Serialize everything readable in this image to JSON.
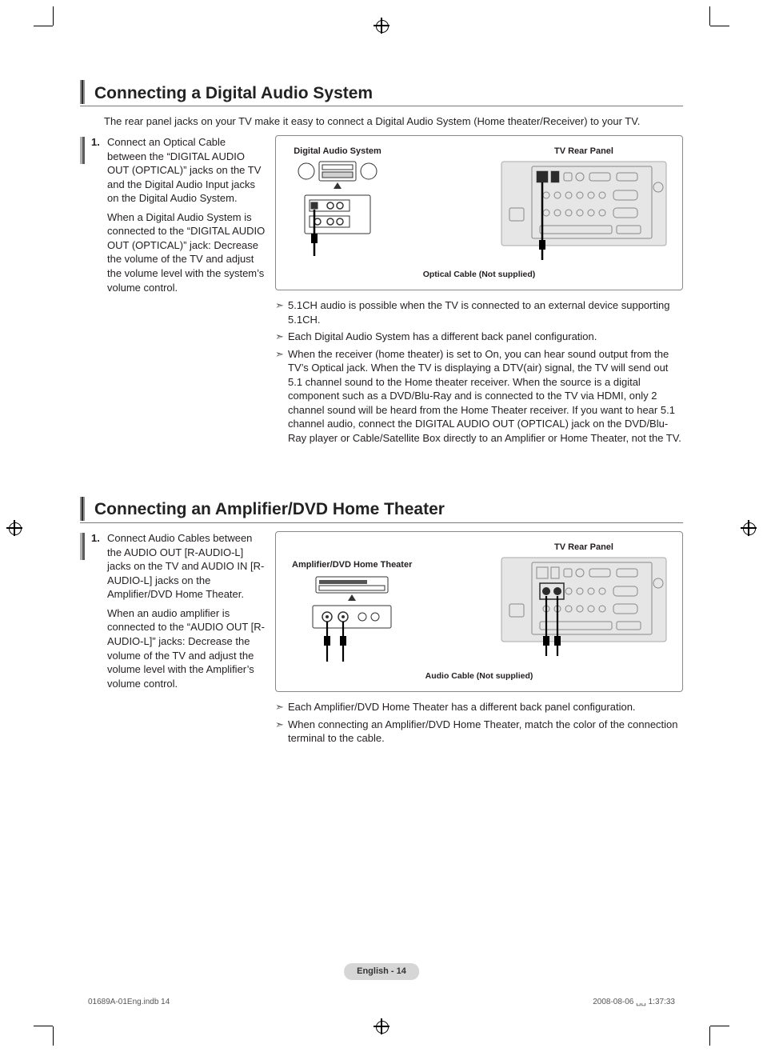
{
  "section1": {
    "title": "Connecting a Digital Audio System",
    "intro": "The rear panel jacks on your TV make it easy to connect a Digital Audio System (Home theater/Receiver) to your TV.",
    "step_number": "1.",
    "step_para1": "Connect an Optical Cable between the “DIGITAL AUDIO OUT (OPTICAL)” jacks on the TV and the Digital Audio Input jacks on the Digital Audio System.",
    "step_para2": "When a Digital Audio System is connected to the “DIGITAL AUDIO OUT (OPTICAL)” jack: Decrease the volume of the TV and adjust the volume level with the system’s volume control.",
    "figure": {
      "left_label": "Digital Audio System",
      "right_label": "TV Rear Panel",
      "cable_label": "Optical Cable (Not supplied)"
    },
    "notes": [
      "5.1CH audio is possible when the TV is connected to an external device supporting 5.1CH.",
      "Each Digital Audio System has a different back panel configuration.",
      "When the receiver (home theater) is set to On, you can hear sound output from the TV’s Optical jack. When the TV is displaying a DTV(air) signal, the TV will send out 5.1 channel sound to the Home theater receiver. When the source is a digital component such as a DVD/Blu-Ray and is connected to the TV via HDMI, only 2 channel sound will be heard from the Home Theater receiver. If you want to hear 5.1 channel audio, connect the DIGITAL AUDIO OUT (OPTICAL) jack on the DVD/Blu-Ray player or Cable/Satellite Box directly to an Amplifier or Home Theater, not the TV."
    ]
  },
  "section2": {
    "title": "Connecting an Amplifier/DVD Home Theater",
    "step_number": "1.",
    "step_para1": "Connect Audio Cables between the AUDIO OUT [R-AUDIO-L] jacks on the TV and AUDIO IN [R-AUDIO-L] jacks on the Amplifier/DVD Home Theater.",
    "step_para2": "When an audio amplifier is connected to the “AUDIO OUT [R-AUDIO-L]” jacks: Decrease the volume of the TV and adjust the volume level with the Amplifier’s volume control.",
    "figure": {
      "left_label": "Amplifier/DVD Home Theater",
      "right_label": "TV Rear Panel",
      "cable_label": "Audio Cable (Not supplied)"
    },
    "notes": [
      "Each Amplifier/DVD Home Theater has a different back panel configuration.",
      "When connecting an Amplifier/DVD Home Theater, match the color of the connection terminal to the cable."
    ]
  },
  "footer": {
    "page_label": "English - 14",
    "doc_id": "01689A-01Eng.indb   14",
    "timestamp": "2008-08-06   ␣␣ 1:37:33"
  }
}
